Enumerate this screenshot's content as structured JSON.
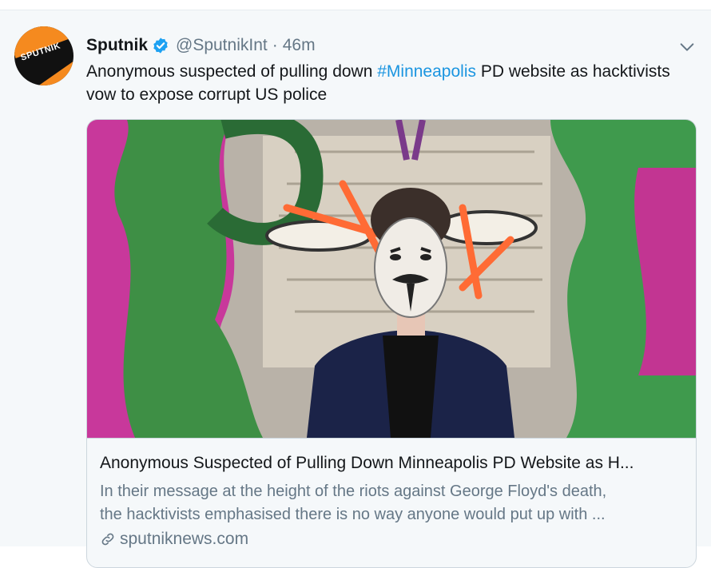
{
  "tweet": {
    "author_name": "Sputnik",
    "handle": "@SputnikInt",
    "separator": "·",
    "time": "46m",
    "avatar_text": "SPUTNIK",
    "text_before": "Anonymous suspected of pulling down ",
    "hashtag": "#Minneapolis",
    "text_after": " PD website as hacktivists vow to expose corrupt US police"
  },
  "card": {
    "title": "Anonymous Suspected of Pulling Down Minneapolis PD Website as H...",
    "description_line1": "In their message at the height of the riots against George Floyd's death,",
    "description_line2": "the hacktivists emphasised there is no way anyone would put up with ...",
    "domain": "sputniknews.com"
  },
  "icons": {
    "verified": "verified-badge-icon",
    "menu": "chevron-down-icon",
    "link": "link-icon"
  },
  "colors": {
    "background": "#f5f8fa",
    "link_blue": "#1b95e0",
    "verified_blue": "#1da1f2",
    "secondary_text": "#657786",
    "brand_orange": "#f58a1f"
  }
}
